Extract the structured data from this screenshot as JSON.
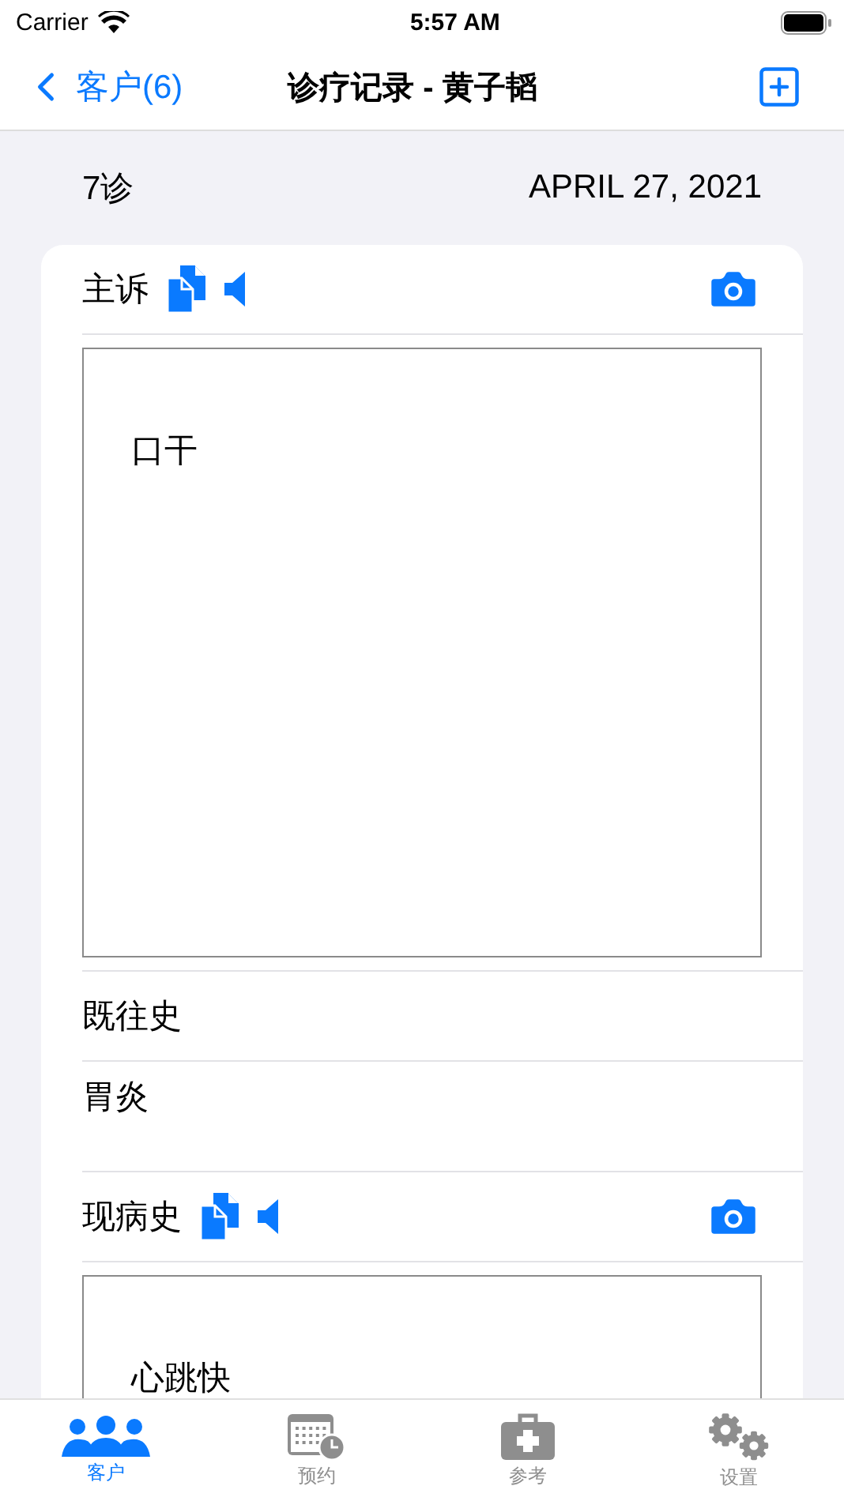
{
  "status_bar": {
    "carrier": "Carrier",
    "time": "5:57 AM"
  },
  "nav": {
    "back_label": "客户(6)",
    "title": "诊疗记录 - 黄子韬"
  },
  "visit": {
    "label": "7诊",
    "date": "APRIL 27, 2021"
  },
  "sections": [
    {
      "kind": "note",
      "title": "主诉",
      "value": "口干"
    },
    {
      "kind": "plain",
      "title": "既往史",
      "value": "胃炎"
    },
    {
      "kind": "note",
      "title": "现病史",
      "value": "心跳快"
    }
  ],
  "tabs": [
    {
      "label": "客户",
      "selected": true
    },
    {
      "label": "预约",
      "selected": false
    },
    {
      "label": "参考",
      "selected": false
    },
    {
      "label": "设置",
      "selected": false
    }
  ]
}
